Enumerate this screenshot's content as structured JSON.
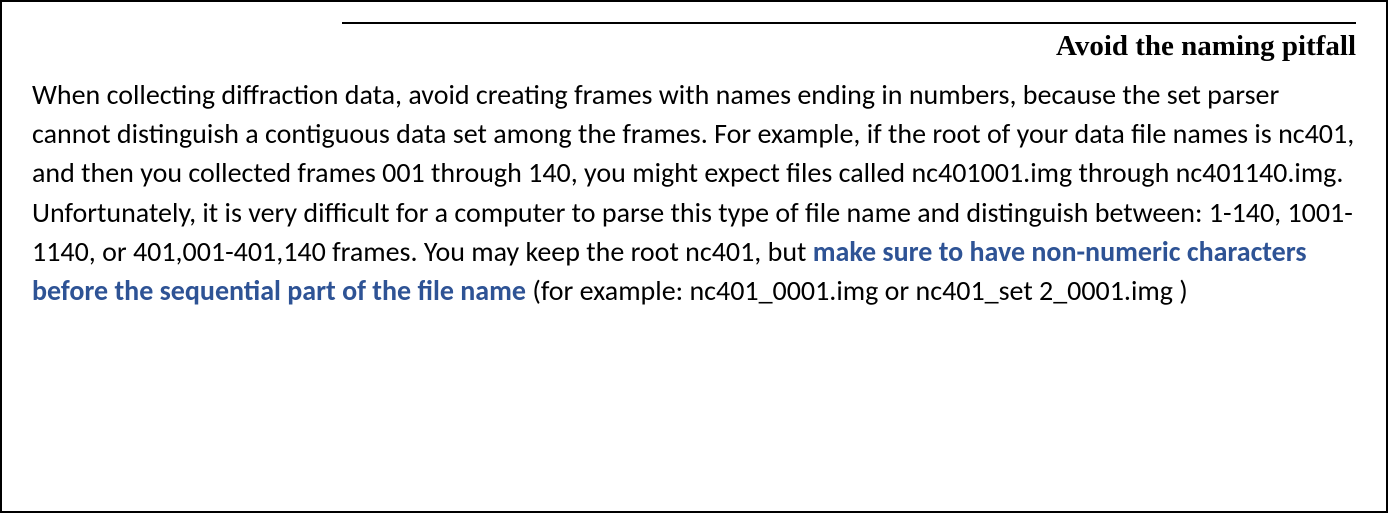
{
  "title": "Avoid the naming pitfall",
  "body": {
    "part1": "When collecting diffraction data, avoid creating frames with names ending in numbers, because the set parser cannot distinguish a contiguous data set among the frames. For example, if the root of your data file names is nc401, and then you collected frames 001 through 140, you might expect files called nc401001.img through nc401140.img. Unfortunately, it is very difficult for a computer to parse this type of file name and distinguish between: 1-140, 1001-1140, or 401,001-401,140 frames. You may keep the root nc401, but ",
    "emphasis": "make sure to have non-numeric characters before the sequential part of the file name",
    "part2": " (for example: nc401_0001.img or nc401_set 2_0001.img )"
  }
}
